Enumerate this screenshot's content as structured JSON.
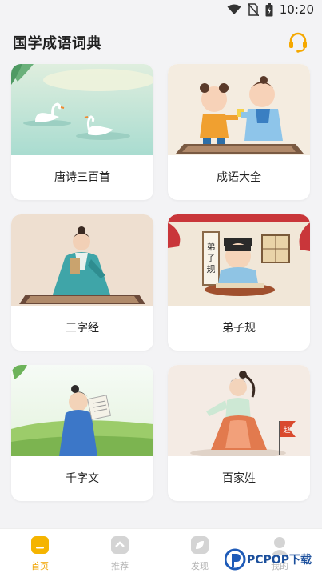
{
  "status_bar": {
    "time": "10:20",
    "icons": [
      "wifi-icon",
      "no-sim-icon",
      "battery-icon"
    ]
  },
  "header": {
    "title": "国学成语词典",
    "support_icon": "headset-icon"
  },
  "cards": [
    {
      "label": "唐诗三百首",
      "image": "swans-on-lake"
    },
    {
      "label": "成语大全",
      "image": "two-children"
    },
    {
      "label": "三字经",
      "image": "scholar-kneeling"
    },
    {
      "label": "弟子规",
      "image": "child-writing"
    },
    {
      "label": "千字文",
      "image": "scholar-reading-scroll"
    },
    {
      "label": "百家姓",
      "image": "girl-with-flag"
    }
  ],
  "flag_character": "赵",
  "scroll_character": "弟子规",
  "bottom_nav": [
    {
      "label": "首页",
      "icon": "home-icon",
      "active": true
    },
    {
      "label": "推荐",
      "icon": "recommend-icon",
      "active": false
    },
    {
      "label": "发现",
      "icon": "discover-icon",
      "active": false
    },
    {
      "label": "我的",
      "icon": "profile-icon",
      "active": false
    }
  ],
  "watermark": {
    "text": "PCPOP下载"
  },
  "colors": {
    "accent": "#f0a400",
    "background": "#f3f3f5",
    "card": "#ffffff",
    "nav_inactive": "#b5b5b5"
  }
}
